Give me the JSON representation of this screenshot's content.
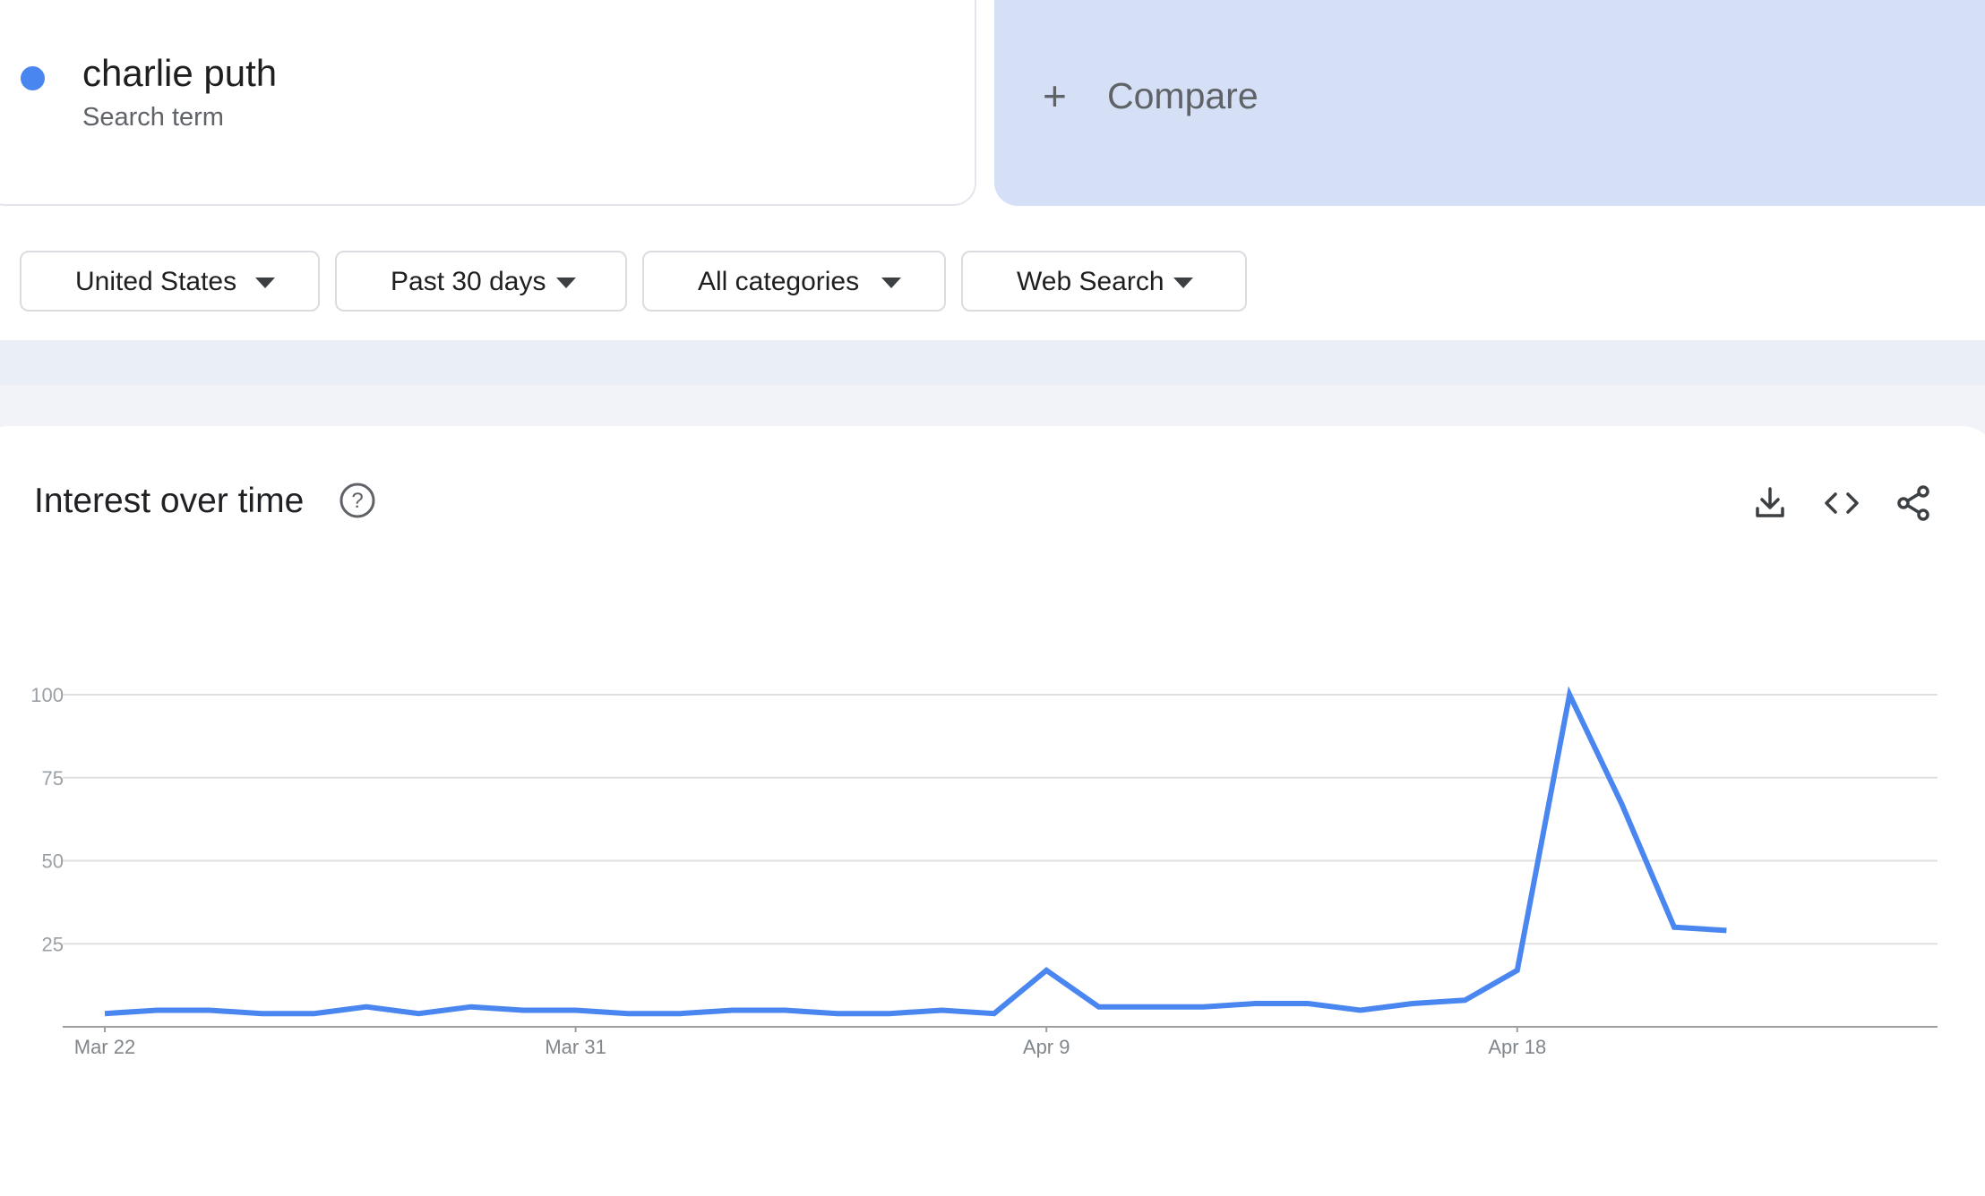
{
  "search_term": {
    "name": "charlie puth",
    "subtitle": "Search term",
    "color": "#4a86f0"
  },
  "compare": {
    "label": "Compare",
    "icon": "plus-icon"
  },
  "filters": [
    {
      "label": "United States",
      "icon": "caret-down-icon"
    },
    {
      "label": "Past 30 days",
      "icon": "caret-down-icon"
    },
    {
      "label": "All categories",
      "icon": "caret-down-icon"
    },
    {
      "label": "Web Search",
      "icon": "caret-down-icon"
    }
  ],
  "chart_section": {
    "title": "Interest over time",
    "help_icon": "help-circle-icon",
    "actions": [
      "download-icon",
      "embed-code-icon",
      "share-icon"
    ]
  },
  "chart_data": {
    "type": "line",
    "title": "Interest over time",
    "x": [
      "Mar 22",
      "Mar 23",
      "Mar 24",
      "Mar 25",
      "Mar 26",
      "Mar 27",
      "Mar 28",
      "Mar 29",
      "Mar 30",
      "Mar 31",
      "Apr 1",
      "Apr 2",
      "Apr 3",
      "Apr 4",
      "Apr 5",
      "Apr 6",
      "Apr 7",
      "Apr 8",
      "Apr 9",
      "Apr 10",
      "Apr 11",
      "Apr 12",
      "Apr 13",
      "Apr 14",
      "Apr 15",
      "Apr 16",
      "Apr 17",
      "Apr 18",
      "Apr 19",
      "Apr 20",
      "Apr 21",
      "Apr 22"
    ],
    "x_tick_labels": [
      "Mar 22",
      "Mar 31",
      "Apr 9",
      "Apr 18"
    ],
    "series": [
      {
        "color": "#4a86f0",
        "values": [
          4,
          5,
          5,
          4,
          4,
          6,
          4,
          6,
          5,
          5,
          4,
          4,
          5,
          5,
          4,
          4,
          5,
          4,
          17,
          6,
          6,
          6,
          7,
          7,
          5,
          7,
          8,
          17,
          100,
          67,
          30,
          29
        ]
      }
    ],
    "yticks": [
      25,
      50,
      75,
      100
    ],
    "ylim": [
      0,
      100
    ],
    "grid": true,
    "xlabel": "",
    "ylabel": ""
  }
}
